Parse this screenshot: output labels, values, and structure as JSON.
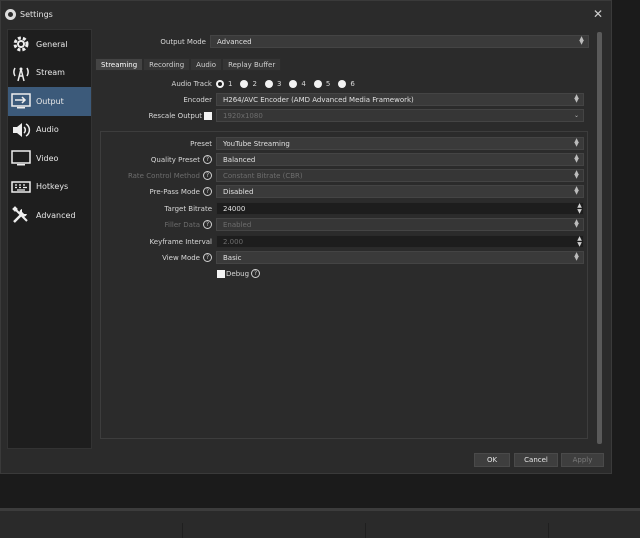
{
  "window": {
    "title": "Settings"
  },
  "sidebar": {
    "items": [
      {
        "label": "General",
        "icon": "gear-icon"
      },
      {
        "label": "Stream",
        "icon": "antenna-icon"
      },
      {
        "label": "Output",
        "icon": "monitor-arrow-icon"
      },
      {
        "label": "Audio",
        "icon": "speaker-icon"
      },
      {
        "label": "Video",
        "icon": "display-icon"
      },
      {
        "label": "Hotkeys",
        "icon": "keyboard-icon"
      },
      {
        "label": "Advanced",
        "icon": "tools-icon"
      }
    ],
    "active_index": 2
  },
  "output": {
    "mode_label": "Output Mode",
    "mode_value": "Advanced",
    "tabs": [
      "Streaming",
      "Recording",
      "Audio",
      "Replay Buffer"
    ],
    "active_tab": "Streaming",
    "audio_track_label": "Audio Track",
    "audio_tracks": [
      "1",
      "2",
      "3",
      "4",
      "5",
      "6"
    ],
    "audio_track_selected": "1",
    "encoder_label": "Encoder",
    "encoder_value": "H264/AVC Encoder (AMD Advanced Media Framework)",
    "rescale_label": "Rescale Output",
    "rescale_value": "1920x1080"
  },
  "settings": {
    "preset_label": "Preset",
    "preset_value": "YouTube Streaming",
    "quality_preset_label": "Quality Preset",
    "quality_preset_value": "Balanced",
    "rate_control_label": "Rate Control Method",
    "rate_control_value": "Constant Bitrate (CBR)",
    "prepass_label": "Pre-Pass Mode",
    "prepass_value": "Disabled",
    "target_bitrate_label": "Target Bitrate",
    "target_bitrate_value": "24000",
    "filler_label": "Filler Data",
    "filler_value": "Enabled",
    "keyframe_label": "Keyframe Interval",
    "keyframe_value": "2.000",
    "view_mode_label": "View Mode",
    "view_mode_value": "Basic",
    "debug_label": "Debug",
    "help_glyph": "?"
  },
  "buttons": {
    "ok": "OK",
    "cancel": "Cancel",
    "apply": "Apply"
  },
  "glyphs": {
    "close": "✕",
    "arrow_up": "▲",
    "arrow_down": "▼"
  }
}
